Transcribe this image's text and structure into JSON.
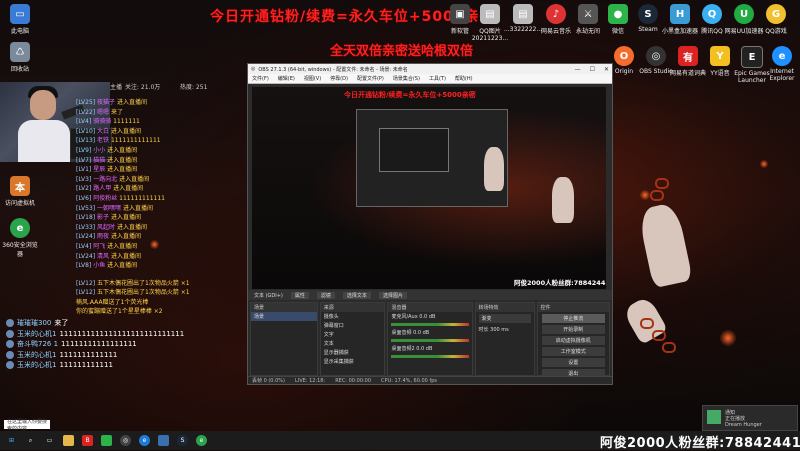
{
  "banner": {
    "line1": "今日开通钻粉/续费=永久车位+5000亲密",
    "line2": "全天双倍亲密送哈根双倍"
  },
  "desktop_left": [
    {
      "label": "此电脑",
      "icon": "computer-icon",
      "color": "#3a7bd5"
    },
    {
      "label": "回收站",
      "icon": "recycle-bin-icon",
      "color": "#7a8a9a"
    }
  ],
  "desktop_top": [
    {
      "label": "新软管",
      "icon": "app-icon",
      "color": "#444"
    },
    {
      "label": "QQ图片20211223...",
      "icon": "image-icon",
      "color": "#bbb"
    },
    {
      "label": "...3322222...",
      "icon": "image-icon",
      "color": "#bbb"
    },
    {
      "label": "网易云音乐",
      "icon": "netease-music-icon",
      "color": "#d33"
    },
    {
      "label": "永劫无间",
      "icon": "game-icon",
      "color": "#555"
    },
    {
      "label": "微信",
      "icon": "wechat-icon",
      "color": "#2db34a"
    },
    {
      "label": "Steam",
      "icon": "steam-icon",
      "color": "#1b2838"
    },
    {
      "label": "小黑盒加速器",
      "icon": "heybox-icon",
      "color": "#3a9bd5"
    },
    {
      "label": "腾讯QQ",
      "icon": "qq-icon",
      "color": "#3ab0f0"
    },
    {
      "label": "网易UU加速器",
      "icon": "uu-icon",
      "color": "#2a4"
    },
    {
      "label": "QQ游戏",
      "icon": "qq-game-icon",
      "color": "#f0c030"
    }
  ],
  "desktop_top2": [
    {
      "label": "Origin",
      "icon": "origin-icon",
      "color": "#f56c2d"
    },
    {
      "label": "OBS Studio",
      "icon": "obs-icon",
      "color": "#333"
    },
    {
      "label": "网易有道词典",
      "icon": "youdao-icon",
      "color": "#d22"
    },
    {
      "label": "YY语音",
      "icon": "yy-icon",
      "color": "#f4c020"
    },
    {
      "label": "Epic Games Launcher",
      "icon": "epic-icon",
      "color": "#222"
    },
    {
      "label": "Internet Explorer",
      "icon": "ie-icon",
      "color": "#1e90ff"
    }
  ],
  "desktop_mid": [
    {
      "label": "访问虚拟机",
      "icon": "vm-icon",
      "color": "#d9772a"
    },
    {
      "label": "360安全浏览器",
      "icon": "360-browser-icon",
      "color": "#2ba24c"
    }
  ],
  "stats": {
    "left": "主播",
    "mid": "关注: 21.0万",
    "right": "热度: 251"
  },
  "chat_lines": [
    {
      "lvl": "[LV25]",
      "name": "夜猫子",
      "text": "进入直播间"
    },
    {
      "lvl": "[LV22]",
      "name": "嗯嗯",
      "text": "来了"
    },
    {
      "lvl": "[LV4]",
      "name": "骑骑骑",
      "text": "1111111"
    },
    {
      "lvl": "[LV10]",
      "name": "大白",
      "text": "进入直播间"
    },
    {
      "lvl": "[LV13]",
      "name": "老铁",
      "text": "1111111111111"
    },
    {
      "lvl": "[LV9]",
      "name": "小小",
      "text": "进入直播间"
    },
    {
      "lvl": "[LV7]",
      "name": "猫猫",
      "text": "进入直播间"
    },
    {
      "lvl": "[LV1]",
      "name": "星辰",
      "text": "进入直播间"
    },
    {
      "lvl": "[LV3]",
      "name": "一路向北",
      "text": "进入直播间"
    },
    {
      "lvl": "[LV2]",
      "name": "路人甲",
      "text": "进入直播间"
    },
    {
      "lvl": "[LV6]",
      "name": "阿俊粉丝",
      "text": "111111111111"
    },
    {
      "lvl": "[LV53]",
      "name": "一朝嘿嘿",
      "text": "进入直播间"
    },
    {
      "lvl": "[LV18]",
      "name": "影子",
      "text": "进入直播间"
    },
    {
      "lvl": "[LV33]",
      "name": "风起时",
      "text": "进入直播间"
    },
    {
      "lvl": "[LV24]",
      "name": "雨夜",
      "text": "进入直播间"
    },
    {
      "lvl": "[LV4]",
      "name": "阿飞",
      "text": "进入直播间"
    },
    {
      "lvl": "[LV24]",
      "name": "清风",
      "text": "进入直播间"
    },
    {
      "lvl": "[LV8]",
      "name": "小鱼",
      "text": "进入直播间"
    }
  ],
  "chat_gifts": [
    {
      "lvl": "[LV12]",
      "text": "五下木偶花圃出了1次物品火箭 ×1"
    },
    {
      "lvl": "[LV12]",
      "text": "五下木偶花圃出了1次物品火箭 ×1"
    },
    {
      "lvl": "",
      "text": "楠风.AAA赠送了1个荧光棒"
    },
    {
      "lvl": "",
      "text": "你的蜜蹦赠送了1个星星棒棒 ×2"
    }
  ],
  "chat_main": [
    {
      "name": "璀璀璀300",
      "text": "来了"
    },
    {
      "name": "玉米的心机1",
      "text": "1111111111111111111111111111"
    },
    {
      "name": "奋斗鸭726 1",
      "text": "11111111111111111"
    },
    {
      "name": "玉米的心机1",
      "text": "1111111111111"
    },
    {
      "name": "玉米的心机1",
      "text": "111111111111"
    }
  ],
  "obs": {
    "title": "OBS 27.1.3 (64-bit, windows) - 配置文件: 未命名 - 场景: 未命名",
    "menu": [
      "文件(F)",
      "编辑(E)",
      "视图(V)",
      "停靠(D)",
      "配置文件(P)",
      "场景集合(S)",
      "工具(T)",
      "帮助(H)"
    ],
    "preview_fans": "阿俊2000人粉丝群:788424410",
    "ctrl_source": "文本 (GDI+)",
    "ctrl_props": "属性",
    "ctrl_filters": "滤镜",
    "ctrl_select": "选择文本",
    "ctrl_text": "选择图片",
    "scenes_header": "场景",
    "scenes": [
      "场景"
    ],
    "sources_header": "来源",
    "sources": [
      "摄像头",
      "弹幕窗口",
      "文字",
      "文本",
      "显示器捕获",
      "显示采集捕获"
    ],
    "mixer_header": "混音器",
    "mixer": [
      {
        "name": "麦克风/Aux",
        "db": "0.0 dB"
      },
      {
        "name": "桌面音频",
        "db": "0.0 dB"
      },
      {
        "name": "桌面音频2",
        "db": "0.0 dB"
      }
    ],
    "transitions_header": "转场特效",
    "transition_value": "渐变",
    "duration_label": "时长",
    "duration_value": "300 ms",
    "controls_header": "控件",
    "controls": [
      "停止推流",
      "开始录制",
      "启动虚拟摄像机",
      "工作室模式",
      "设置",
      "退出"
    ],
    "status": [
      "丢帧 0 (0.0%)",
      "LIVE: 12:18:",
      "REC: 00:00:00",
      "CPU: 17.4%, 60.00 fps"
    ]
  },
  "taskbar_fans": "阿俊2000人粉丝群:788424410",
  "search_placeholder": "在这里输入你要搜索的内容",
  "notification": {
    "title": "通知",
    "sub": "正在播放",
    "body": "Dream Hunger"
  }
}
